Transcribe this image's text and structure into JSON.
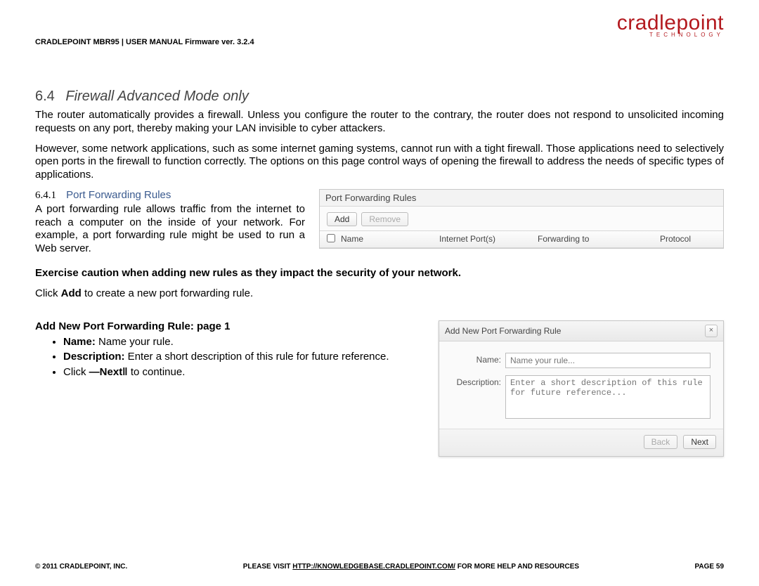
{
  "header": {
    "doc_line": "CRADLEPOINT MBR95 | USER MANUAL Firmware ver. 3.2.4",
    "logo_brand": "cradlepoint",
    "logo_sub": "TECHNOLOGY"
  },
  "section": {
    "num": "6.4",
    "title": "Firewall Advanced Mode only",
    "para1": "The router automatically provides a firewall. Unless you configure the router to the contrary, the router does not respond to unsolicited incoming requests on any port, thereby making your LAN invisible to cyber attackers.",
    "para2": "However, some network applications, such as some internet gaming systems, cannot run with a tight firewall. Those applications need to selectively open ports in the firewall to function correctly. The options on this page control ways of opening the firewall to address the needs of specific types of applications."
  },
  "subsection": {
    "num": "6.4.1",
    "title": "Port Forwarding Rules",
    "para": "A port forwarding rule allows traffic from the internet to reach a computer on the inside of your network. For example, a port forwarding rule might be used to run a Web server."
  },
  "panel_pfr": {
    "title": "Port Forwarding Rules",
    "btn_add": "Add",
    "btn_remove": "Remove",
    "cols": {
      "name": "Name",
      "ports": "Internet Port(s)",
      "fwd": "Forwarding to",
      "proto": "Protocol"
    }
  },
  "warn": "Exercise caution when adding new rules as they impact the security of your network.",
  "click_add_pre": "Click ",
  "click_add_bold": "Add",
  "click_add_post": " to create a new port forwarding rule.",
  "add_rule": {
    "heading": "Add New Port Forwarding Rule: page 1",
    "b1_label": "Name:",
    "b1_text": " Name your rule.",
    "b2_label": "Description:",
    "b2_text": " Enter a short description of this rule for future reference.",
    "b3_pre": "Click ",
    "b3_mid": "―Next‖",
    "b3_post": " to continue."
  },
  "dialog": {
    "title": "Add New Port Forwarding Rule",
    "close": "×",
    "name_label": "Name:",
    "name_placeholder": "Name your rule...",
    "desc_label": "Description:",
    "desc_placeholder": "Enter a short description of this rule for future reference...",
    "btn_back": "Back",
    "btn_next": "Next"
  },
  "footer": {
    "left": "© 2011 CRADLEPOINT, INC.",
    "mid_pre": "PLEASE VISIT ",
    "mid_link": "HTTP://KNOWLEDGEBASE.CRADLEPOINT.COM/",
    "mid_post": " FOR MORE HELP AND RESOURCES",
    "right": "PAGE 59"
  }
}
